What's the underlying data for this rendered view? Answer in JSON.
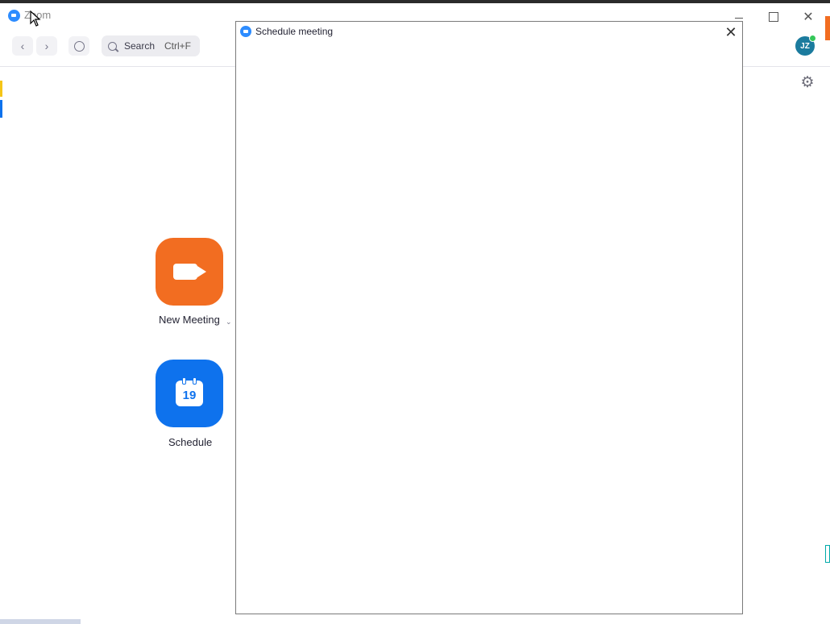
{
  "window": {
    "title": "Zoom",
    "min_glyph": "",
    "close_glyph": "✕"
  },
  "toolbar": {
    "back_glyph": "‹",
    "forward_glyph": "›",
    "search_label": "Search",
    "search_shortcut": "Ctrl+F"
  },
  "profile": {
    "initials": "JZ",
    "status_color": "#34c759"
  },
  "settings": {
    "glyph": "⚙"
  },
  "home": {
    "new_meeting_label": "New Meeting",
    "new_meeting_caret": "⌄",
    "schedule_label": "Schedule",
    "calendar_day": "19"
  },
  "dialog": {
    "title": "Schedule meeting",
    "close_glyph": "✕"
  },
  "colors": {
    "accent_blue": "#0e72ed",
    "new_meeting_orange": "#f26d21"
  }
}
